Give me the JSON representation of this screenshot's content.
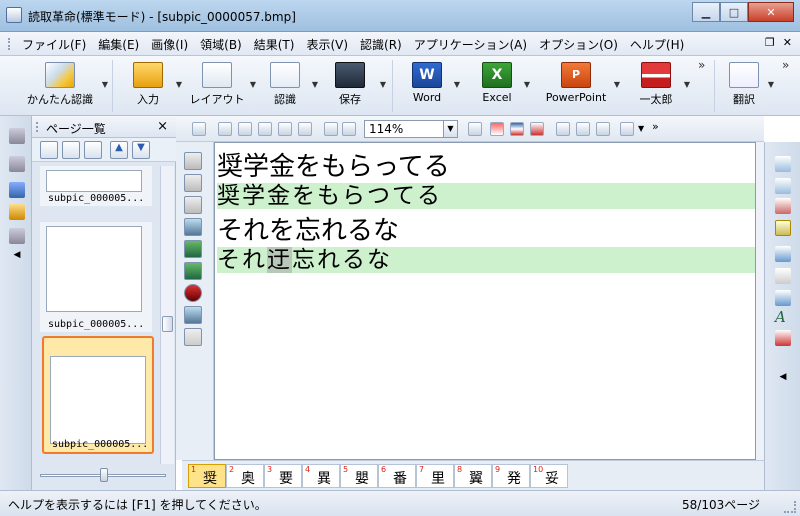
{
  "window": {
    "title": "読取革命(標準モード) - [subpic_0000057.bmp]",
    "controls": [
      "minimize",
      "maximize",
      "close"
    ]
  },
  "menubar": {
    "items": [
      "ファイル(F)",
      "編集(E)",
      "画像(I)",
      "領域(B)",
      "結果(T)",
      "表示(V)",
      "認識(R)",
      "アプリケーション(A)",
      "オプション(O)",
      "ヘルプ(H)"
    ],
    "mdi": [
      "restore",
      "close"
    ]
  },
  "toolbar": {
    "easy": "かんたん認識",
    "input": "入力",
    "layout": "レイアウト",
    "recognize": "認識",
    "save": "保存",
    "word": "Word",
    "excel": "Excel",
    "powerpoint": "PowerPoint",
    "ichitaro": "一太郎",
    "translate": "翻訳"
  },
  "pagepanel": {
    "title": "ページ一覧",
    "close": "×",
    "thumbnails": [
      {
        "caption": "subpic_000005..."
      },
      {
        "caption": "subpic_000005..."
      },
      {
        "caption": "subpic_000005..."
      }
    ]
  },
  "doctools": {
    "zoom": "114%"
  },
  "document": {
    "lines": [
      {
        "type": "original",
        "text": "奨学金をもらってる"
      },
      {
        "type": "recognized",
        "text": "奨学金をもらつてる"
      },
      {
        "type": "original",
        "text": "それを忘れるな"
      },
      {
        "type": "recognized",
        "text_before": "それ",
        "text_unsure": "迂",
        "text_after": "忘れるな"
      }
    ]
  },
  "candidates": [
    {
      "n": "1",
      "c": "奨"
    },
    {
      "n": "2",
      "c": "奥"
    },
    {
      "n": "3",
      "c": "要"
    },
    {
      "n": "4",
      "c": "異"
    },
    {
      "n": "5",
      "c": "嬰"
    },
    {
      "n": "6",
      "c": "番"
    },
    {
      "n": "7",
      "c": "里"
    },
    {
      "n": "8",
      "c": "翼"
    },
    {
      "n": "9",
      "c": "発"
    },
    {
      "n": "10",
      "c": "妥"
    }
  ],
  "statusbar": {
    "help": "ヘルプを表示するには [F1] を押してください。",
    "page": "58/103ページ"
  }
}
